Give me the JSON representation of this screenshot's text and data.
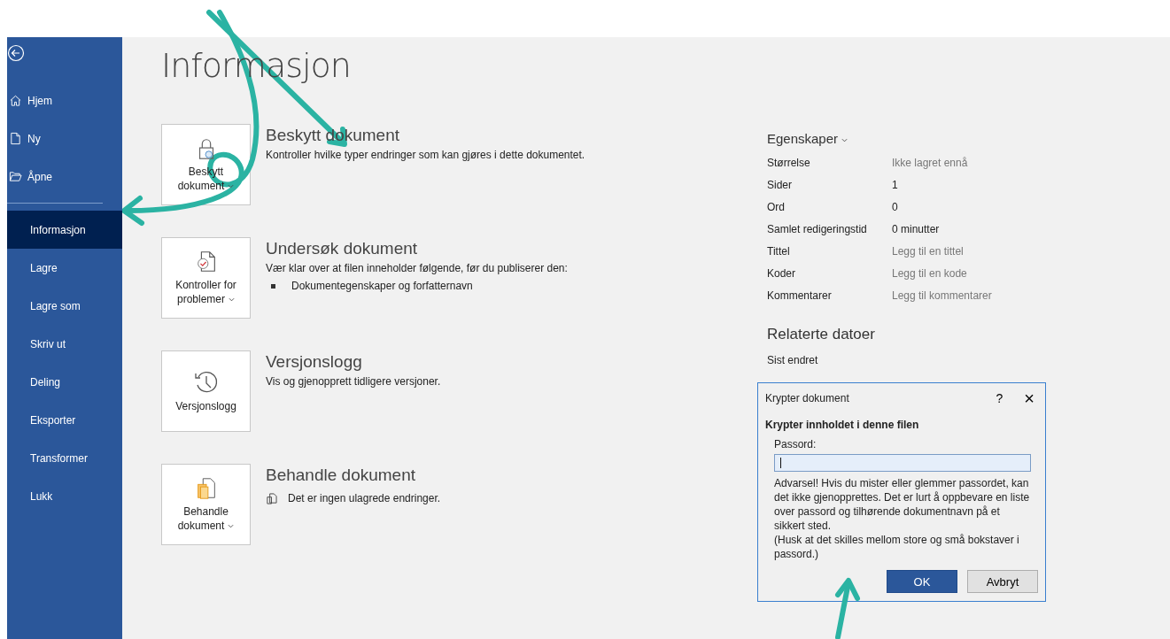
{
  "page_title": "Informasjon",
  "sidebar": {
    "items": [
      {
        "label": "Hjem",
        "kind": "home",
        "selected": false
      },
      {
        "label": "Ny",
        "kind": "new",
        "selected": false
      },
      {
        "label": "Åpne",
        "kind": "open",
        "selected": false
      },
      {
        "label": "Informasjon",
        "kind": "text",
        "selected": true
      },
      {
        "label": "Lagre",
        "kind": "text",
        "selected": false
      },
      {
        "label": "Lagre som",
        "kind": "text",
        "selected": false
      },
      {
        "label": "Skriv ut",
        "kind": "text",
        "selected": false
      },
      {
        "label": "Deling",
        "kind": "text",
        "selected": false
      },
      {
        "label": "Eksporter",
        "kind": "text",
        "selected": false
      },
      {
        "label": "Transformer",
        "kind": "text",
        "selected": false
      },
      {
        "label": "Lukk",
        "kind": "text",
        "selected": false
      }
    ]
  },
  "sections": [
    {
      "kind": "protect",
      "button": "Beskytt dokument",
      "dropdown": true,
      "heading": "Beskytt dokument",
      "description": "Kontroller hvilke typer endringer som kan gjøres i dette dokumentet."
    },
    {
      "kind": "inspect",
      "button": "Kontroller for problemer",
      "dropdown": true,
      "heading": "Undersøk dokument",
      "description": "Vær klar over at filen inneholder følgende, før du publiserer den:",
      "bullets": [
        "Dokumentegenskaper og forfatternavn"
      ]
    },
    {
      "kind": "history",
      "button": "Versjonslogg",
      "dropdown": false,
      "heading": "Versjonslogg",
      "description": "Vis og gjenopprett tidligere versjoner."
    },
    {
      "kind": "manage",
      "button": "Behandle dokument",
      "dropdown": true,
      "heading": "Behandle dokument",
      "note": "Det er ingen ulagrede endringer."
    }
  ],
  "properties": {
    "heading": "Egenskaper",
    "rows": [
      {
        "label": "Størrelse",
        "value": "Ikke lagret ennå",
        "placeholder": true
      },
      {
        "label": "Sider",
        "value": "1",
        "placeholder": false
      },
      {
        "label": "Ord",
        "value": "0",
        "placeholder": false
      },
      {
        "label": "Samlet redigeringstid",
        "value": "0 minutter",
        "placeholder": false
      },
      {
        "label": "Tittel",
        "value": "Legg til en tittel",
        "placeholder": true
      },
      {
        "label": "Koder",
        "value": "Legg til en kode",
        "placeholder": true
      },
      {
        "label": "Kommentarer",
        "value": "Legg til kommentarer",
        "placeholder": true
      }
    ]
  },
  "related_dates": {
    "heading": "Relaterte datoer",
    "rows": [
      {
        "label": "Sist endret"
      }
    ]
  },
  "dialog": {
    "title": "Krypter dokument",
    "help": "?",
    "close": "×",
    "heading": "Krypter innholdet i denne filen",
    "field_label": "Passord:",
    "warning": "Advarsel!  Hvis du mister eller glemmer passordet, kan det ikke gjenopprettes. Det er lurt å oppbevare en liste over passord og tilhørende dokumentnavn på et sikkert sted.",
    "hint": "(Husk at det skilles mellom store og små bokstaver i passord.)",
    "buttons": [
      {
        "label": "OK",
        "selected": true
      },
      {
        "label": "Avbryt",
        "selected": false
      }
    ]
  }
}
